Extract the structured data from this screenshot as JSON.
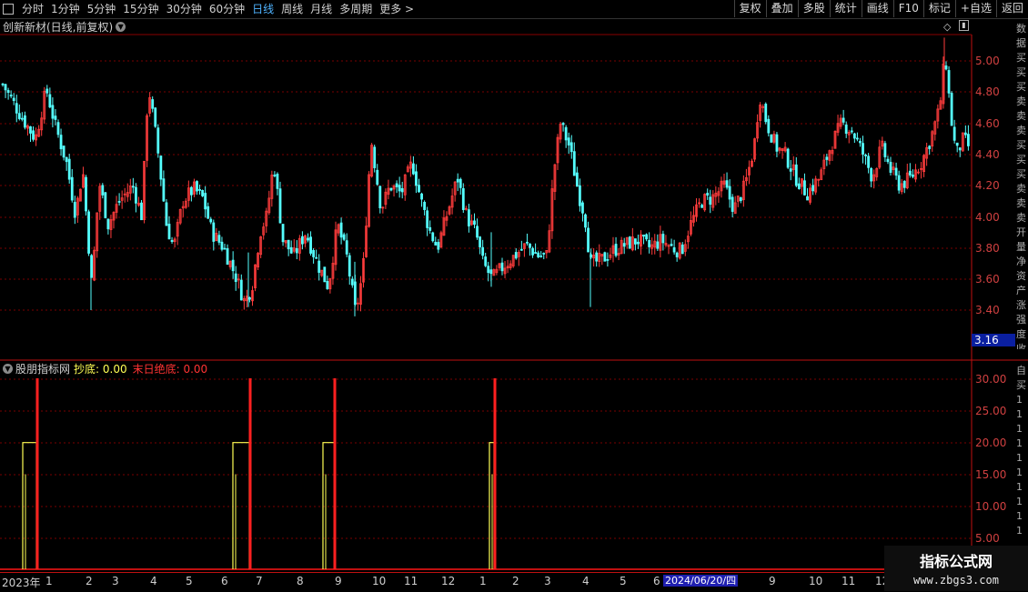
{
  "toolbar": {
    "tabs": [
      {
        "label": ""
      },
      {
        "label": "分时"
      },
      {
        "label": "1分钟"
      },
      {
        "label": "5分钟"
      },
      {
        "label": "15分钟"
      },
      {
        "label": "30分钟"
      },
      {
        "label": "60分钟"
      },
      {
        "label": "日线",
        "active": true
      },
      {
        "label": "周线"
      },
      {
        "label": "月线"
      },
      {
        "label": "多周期"
      },
      {
        "label": "更多 >"
      }
    ],
    "right_buttons": [
      "复权",
      "叠加",
      "多股",
      "统计",
      "画线",
      "F10",
      "标记",
      "+自选",
      "返回"
    ]
  },
  "main_chart": {
    "title": "创新新材(日线,前复权)",
    "price_axis": [
      "5.00",
      "4.80",
      "4.60",
      "4.40",
      "4.20",
      "4.00",
      "3.80",
      "3.60",
      "3.40"
    ],
    "last_price": "3.16",
    "side_strip_text": "数据买买买卖卖卖买买买卖卖卖开量净资产涨强度收"
  },
  "indicator": {
    "name": "股朋指标网",
    "line1_label": "抄底: 0.00",
    "line2_label": "末日绝底: 0.00",
    "axis": [
      "30.00",
      "25.00",
      "20.00",
      "15.00",
      "10.00",
      "5.00"
    ],
    "side_strip_text": "自买1111111111"
  },
  "date_axis": {
    "ticks": [
      "2023年",
      "1",
      "2",
      "3",
      "4",
      "5",
      "6",
      "7",
      "8",
      "9",
      "10",
      "11",
      "12",
      "1",
      "2",
      "3",
      "4",
      "5",
      "6",
      "9",
      "10",
      "11",
      "12"
    ],
    "highlight": "2024/06/20/四"
  },
  "watermark": {
    "line1": "指标公式网",
    "line2": "www.zbgs3.com"
  },
  "colors": {
    "up": "#ff3c3c",
    "down": "#54ffff",
    "grid": "#7a0000",
    "signal_yellow": "#ffff55",
    "signal_red": "#ff2020"
  }
}
